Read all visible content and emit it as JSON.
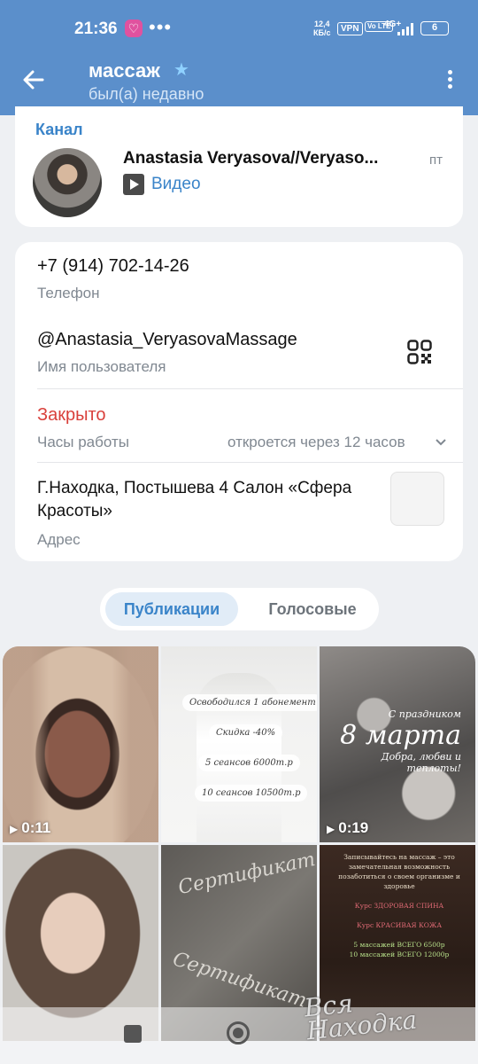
{
  "status_bar": {
    "time": "21:36",
    "dots": "•••",
    "speed_value": "12,4",
    "speed_unit": "КБ/с",
    "vpn": "VPN",
    "volte": "Vo LTE",
    "network": "4G+",
    "battery": "6"
  },
  "header": {
    "title": "массаж",
    "subtitle": "был(а) недавно",
    "accent": "#5b8fcb"
  },
  "channel": {
    "section_label": "Канал",
    "name": "Anastasia Veryasova//Veryaso...",
    "date": "пт",
    "preview": "Видео"
  },
  "info": {
    "phone": "+7 (914) 702-14-26",
    "phone_label": "Телефон",
    "username": "@Anastasia_VeryasovaMassage",
    "username_label": "Имя пользователя",
    "hours_status": "Закрыто",
    "hours_label": "Часы работы",
    "hours_detail": "откроется через 12 часов",
    "address": "Г.Находка, Постышева 4 Салон «Сфера Красоты»",
    "address_label": "Адрес"
  },
  "tabs": {
    "active": "Публикации",
    "other": "Голосовые"
  },
  "grid": {
    "v1_duration": "0:11",
    "v3_duration": "0:19",
    "promo_1": "Освободился 1 абонемент",
    "promo_2": "Скидка -40%",
    "promo_3": "5 сеансов 6000т.р",
    "promo_4": "10 сеансов 10500т.р",
    "holiday_top": "С праздником",
    "holiday_big": "8 марта",
    "holiday_bottom": "Добра, любви и теплоты!",
    "cert_1": "Сертификат",
    "cert_2": "Сертификат",
    "dark_1": "Записывайтесь на массаж – это замечательная возможность позаботиться о своем организме и здоровье",
    "dark_2": "Курс ЗДОРОВАЯ СПИНА",
    "dark_3": "Курс КРАСИВАЯ КОЖА",
    "dark_4": "5 массажей ВСЕГО 6500р",
    "dark_5": "10 массажей ВСЕГО 12000р"
  },
  "watermark": "Вся Находка"
}
